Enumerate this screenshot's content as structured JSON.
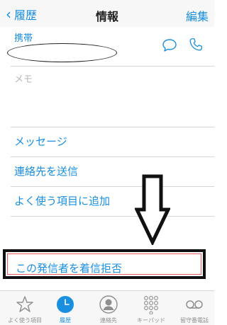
{
  "nav": {
    "back_label": "履歴",
    "title": "情報",
    "edit_label": "編集"
  },
  "contact": {
    "phone_type": "携帯",
    "memo_placeholder": "メモ"
  },
  "actions": [
    {
      "label": "メッセージ"
    },
    {
      "label": "連絡先を送信"
    },
    {
      "label": "よく使う項目に追加"
    }
  ],
  "block_caller": {
    "label": "この発信者を着信拒否"
  },
  "tabs": [
    {
      "label": "よく使う項目",
      "icon": "star-icon"
    },
    {
      "label": "履歴",
      "icon": "clock-icon",
      "active": true
    },
    {
      "label": "連絡先",
      "icon": "contacts-icon"
    },
    {
      "label": "キーパッド",
      "icon": "keypad-icon"
    },
    {
      "label": "留守番電話",
      "icon": "voicemail-icon"
    }
  ],
  "colors": {
    "accent": "#1a8fe0",
    "tab_inactive": "#8f8f8f",
    "highlight_border": "#111111",
    "highlight_inner_border": "#e45d5d"
  }
}
